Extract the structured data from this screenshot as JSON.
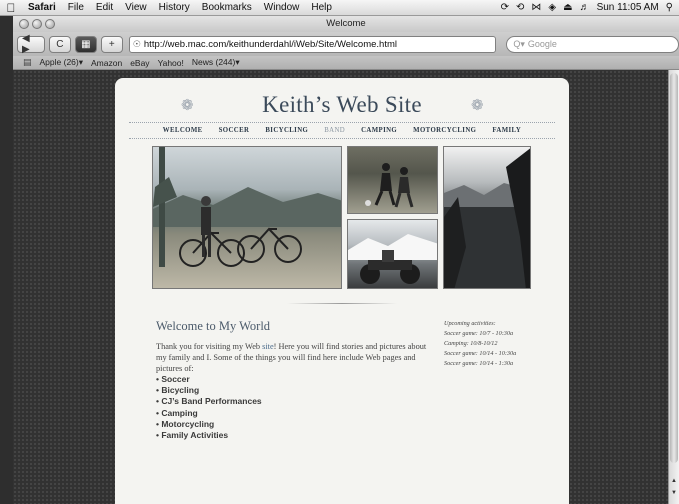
{
  "menubar": {
    "apple_icon": "apple-icon",
    "app_name": "Safari",
    "items": [
      "File",
      "Edit",
      "View",
      "History",
      "Bookmarks",
      "Window",
      "Help"
    ],
    "clock": "Sun 11:05 AM"
  },
  "window": {
    "title": "Welcome"
  },
  "toolbar": {
    "back_forward": "◀ ▶",
    "reload": "C",
    "add": "+",
    "url": "http://web.mac.com/keithunderdahl/iWeb/Site/Welcome.html",
    "search_placeholder": "Google"
  },
  "bookmarks": {
    "items": [
      "Apple (26)▾",
      "Amazon",
      "eBay",
      "Yahoo!",
      "News (244)▾"
    ]
  },
  "site": {
    "title": "Keith’s Web Site",
    "nav": [
      "WELCOME",
      "SOCCER",
      "BICYCLING",
      "BAND",
      "CAMPING",
      "MOTORCYCLING",
      "FAMILY"
    ],
    "welcome_heading": "Welcome to My World",
    "intro_before_link": "Thank you for visiting my Web ",
    "intro_link": "site",
    "intro_after_link": "! Here you will find stories and pictures about my family and I. Some of the things you will find here include Web pages and pictures of:",
    "interests": [
      "Soccer",
      "Bicycling",
      "CJ’s Band Performances",
      "Camping",
      "Motorcycling",
      "Family Activities"
    ],
    "activities": {
      "heading": "Upcoming activities:",
      "items": [
        "Soccer game: 10/7 - 10:30a",
        "Camping: 10/8-10/12",
        "Soccer game: 10/14 - 10:30a",
        "Soccer game: 10/14 - 1:30a"
      ]
    }
  }
}
